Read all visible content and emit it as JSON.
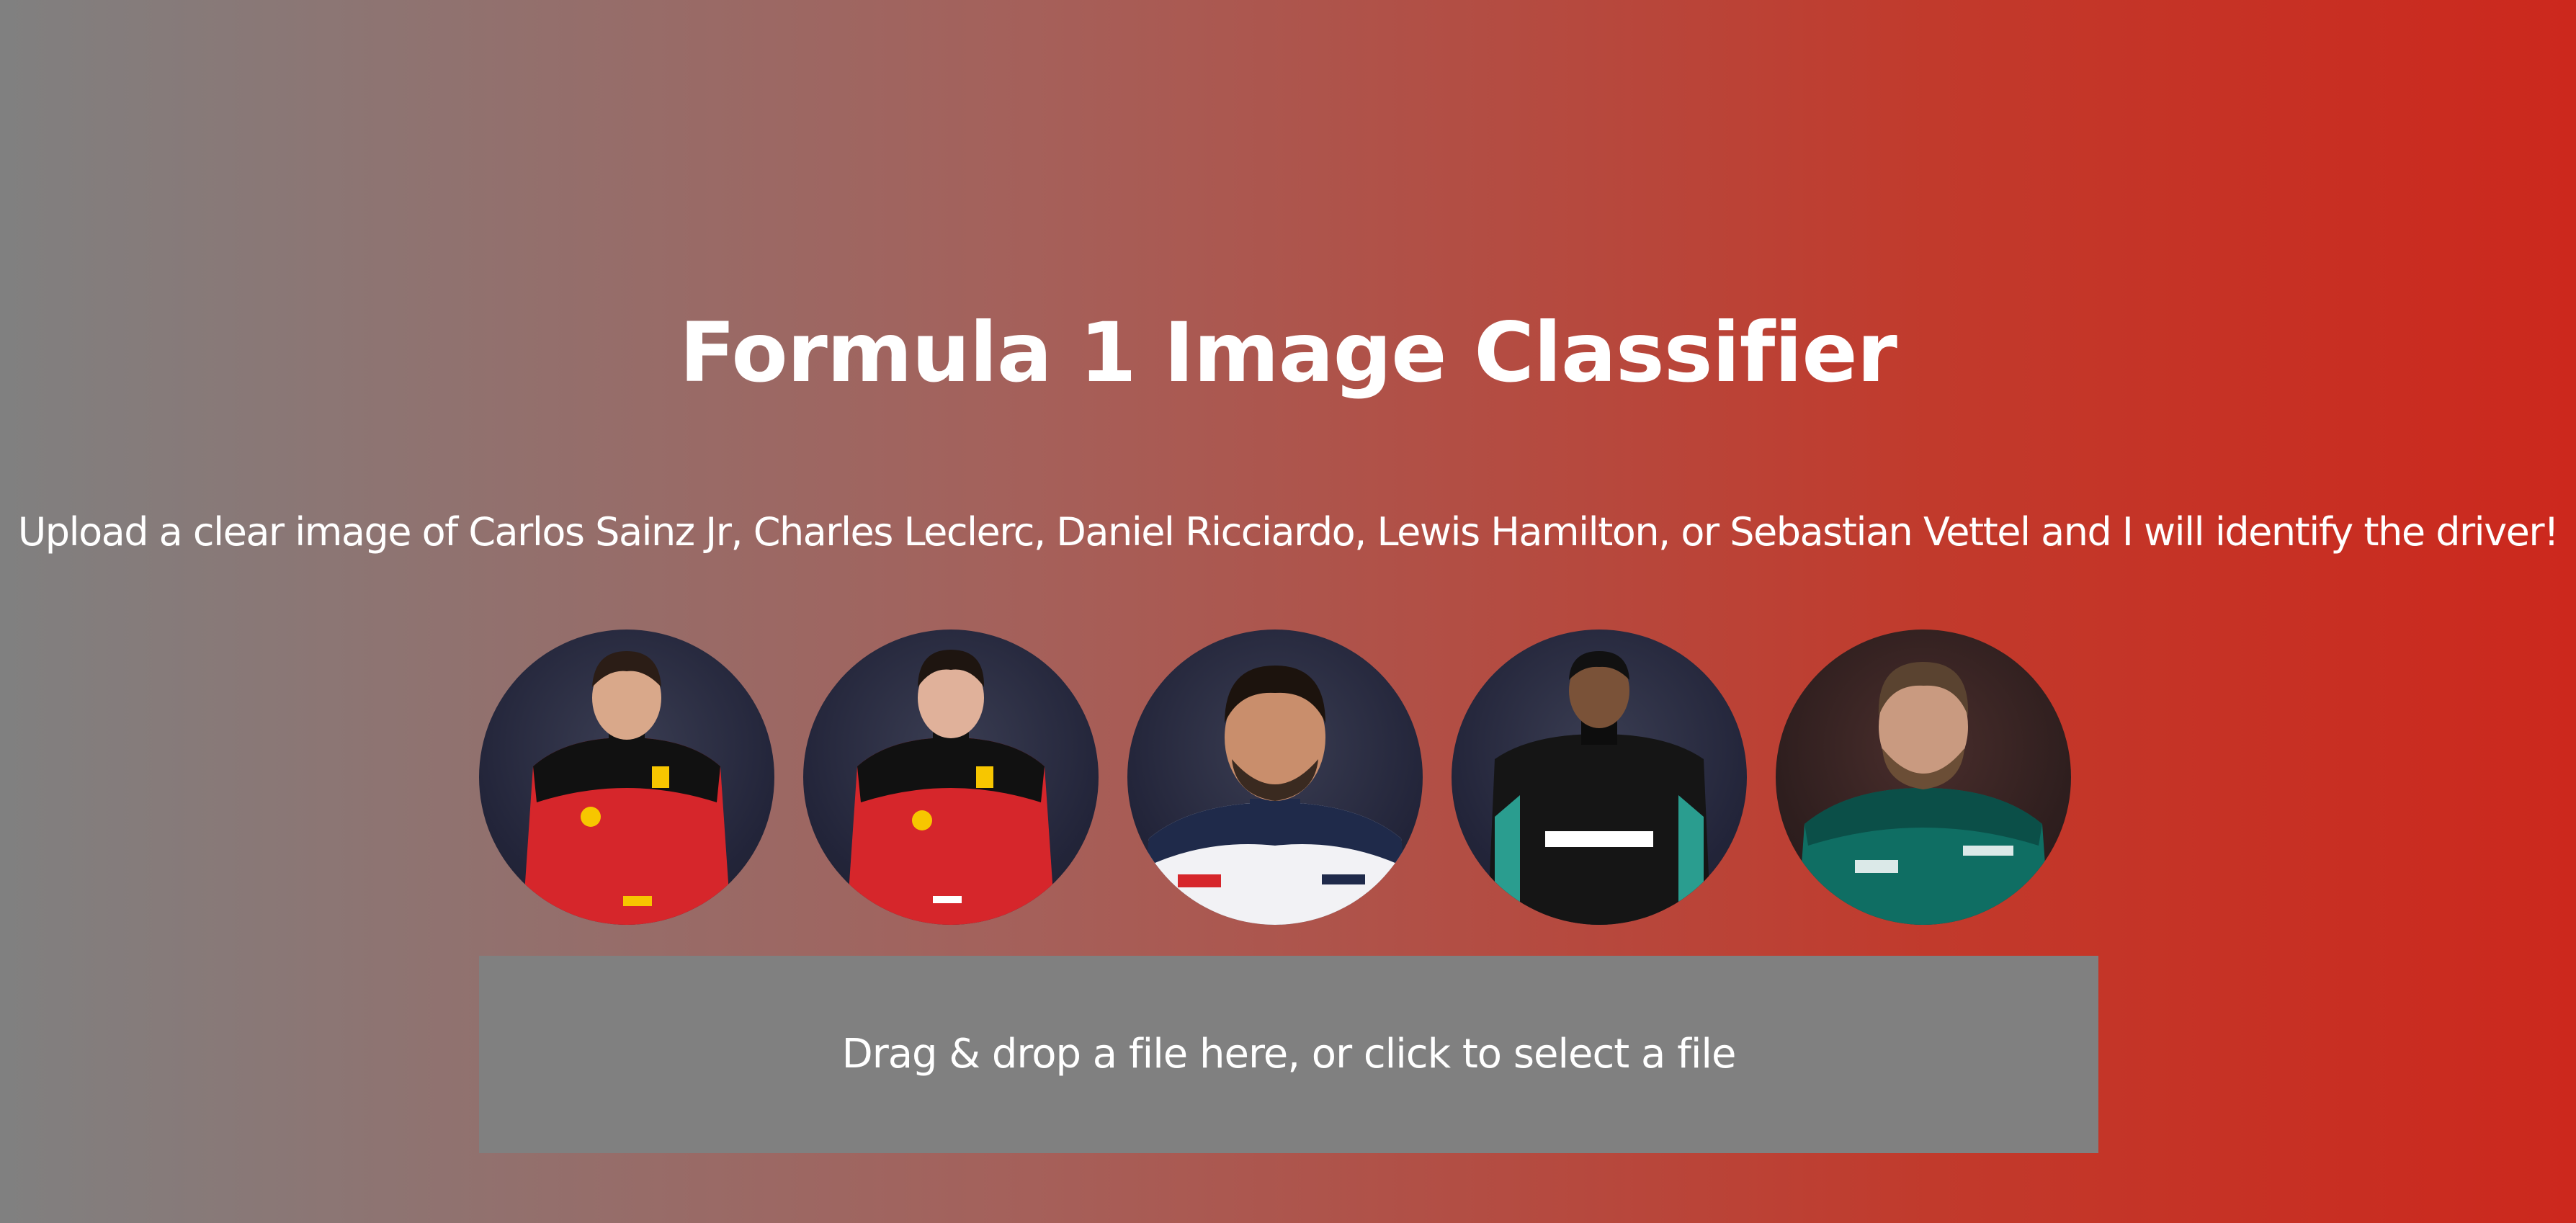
{
  "page": {
    "title": "Formula 1 Image Classifier",
    "subtitle": "Upload a clear image of Carlos Sainz Jr, Charles Leclerc, Daniel Ricciardo, Lewis Hamilton, or Sebastian Vettel and I will identify the driver!"
  },
  "drivers": [
    {
      "name": "Carlos Sainz Jr",
      "suit": "#d6262b",
      "accent": "#111111"
    },
    {
      "name": "Charles Leclerc",
      "suit": "#d6262b",
      "accent": "#111111"
    },
    {
      "name": "Daniel Ricciardo",
      "suit": "#f2f2f5",
      "accent": "#1f2a4a"
    },
    {
      "name": "Lewis Hamilton",
      "suit": "#151515",
      "accent": "#2a9d8f"
    },
    {
      "name": "Sebastian Vettel",
      "suit": "#0f6e63",
      "accent": "#0b4f48"
    }
  ],
  "dropzone": {
    "label": "Drag & drop a file here, or click to select a file"
  },
  "colors": {
    "gradient_start": "#808080",
    "gradient_end": "#cc281d",
    "dropzone_bg": "#808080"
  }
}
